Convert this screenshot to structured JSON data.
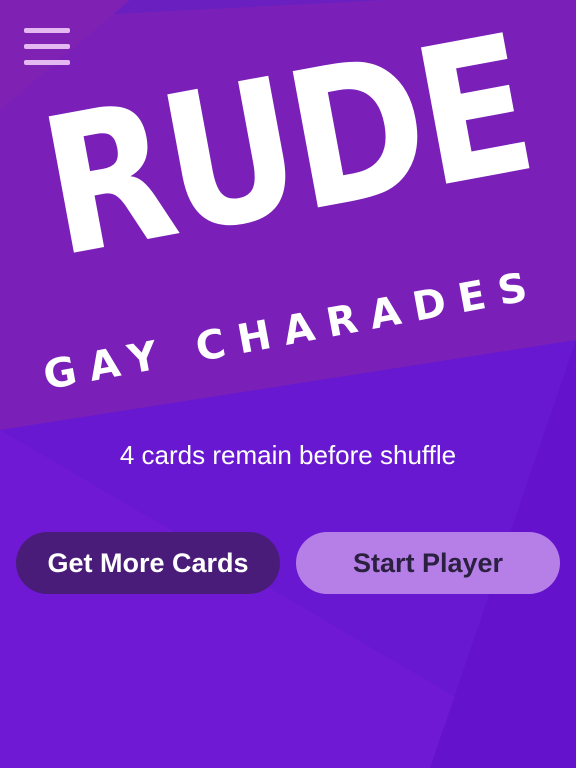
{
  "colors": {
    "background_top": "#6a1fc0",
    "banner_band": "#7d1fb3",
    "background_bottom": "#6a16d3",
    "menu_icon": "#e4b9f2",
    "get_more_button_bg": "#4a1c7a",
    "start_player_button_bg": "#b67fe8",
    "start_player_text": "#2b2040",
    "text": "#ffffff"
  },
  "menu": {
    "icon": "hamburger-menu-icon"
  },
  "logo": {
    "title": "RUDE",
    "subtitle": "GAY CHARADES"
  },
  "status": {
    "remaining_text": "4 cards remain before shuffle"
  },
  "actions": {
    "get_more_label": "Get More Cards",
    "start_player_label": "Start Player"
  }
}
